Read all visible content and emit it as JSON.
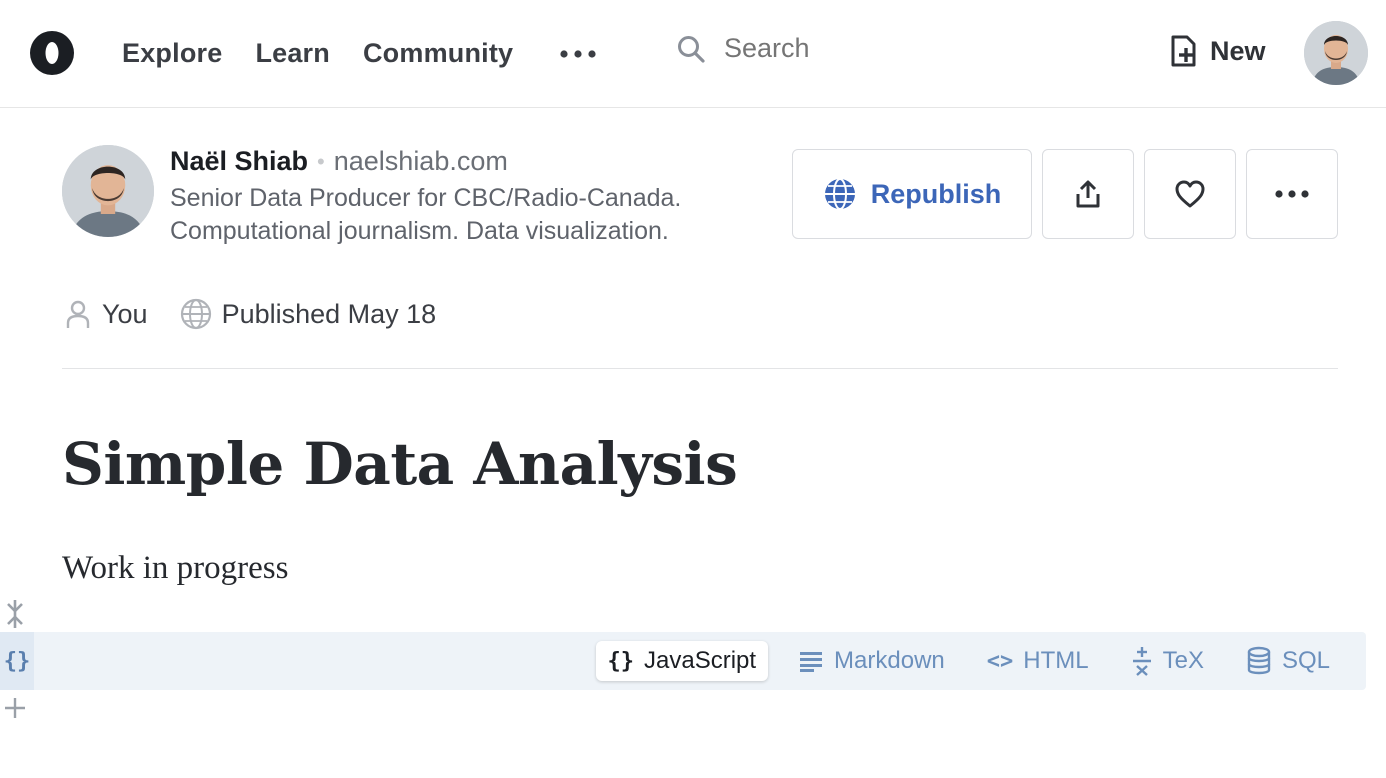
{
  "nav": {
    "items": [
      {
        "label": "Explore"
      },
      {
        "label": "Learn"
      },
      {
        "label": "Community"
      }
    ],
    "more_icon": "more-horizontal-icon"
  },
  "search": {
    "placeholder": "Search",
    "icon": "search-icon"
  },
  "new_button": {
    "label": "New",
    "icon": "new-notebook-icon"
  },
  "author": {
    "name": "Naël Shiab",
    "site": "naelshiab.com",
    "bio": "Senior Data Producer for CBC/Radio-Canada. Computational journalism. Data visualization."
  },
  "actions": {
    "republish_label": "Republish",
    "republish_icon": "globe-icon",
    "share_icon": "share-icon",
    "like_icon": "heart-icon",
    "more_icon": "more-horizontal-icon"
  },
  "meta": {
    "owner": "You",
    "published": "Published May 18"
  },
  "document": {
    "title": "Simple Data Analysis",
    "subtitle": "Work in progress"
  },
  "cell": {
    "gutter_glyph": "{}",
    "modes": [
      {
        "label": "JavaScript",
        "glyph": "{}",
        "active": true
      },
      {
        "label": "Markdown",
        "icon": "markdown-icon"
      },
      {
        "label": "HTML",
        "glyph": "<>"
      },
      {
        "label": "TeX",
        "icon": "tex-icon"
      },
      {
        "label": "SQL",
        "icon": "database-icon"
      }
    ]
  },
  "colors": {
    "accent": "#3c66b8",
    "cell_background": "#eef3f8",
    "mode_inactive": "#6b8fbc"
  }
}
